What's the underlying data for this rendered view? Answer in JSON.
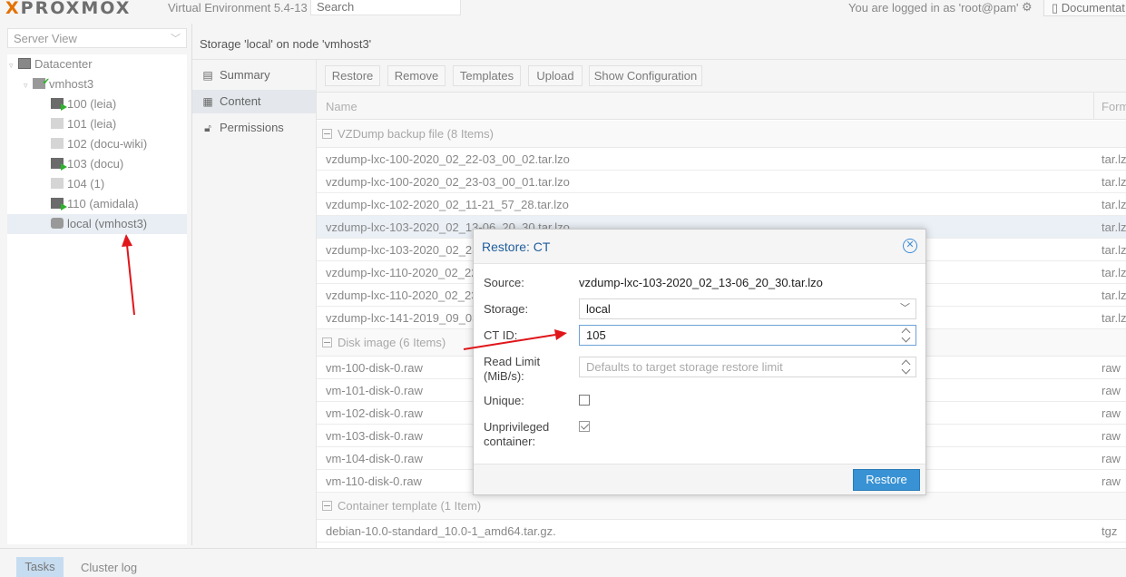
{
  "header": {
    "logo_x": "X",
    "logo_rest": "PROXMOX",
    "version": "Virtual Environment 5.4-13",
    "search_placeholder": "Search",
    "logged_in": "You are logged in as 'root@pam'",
    "gear_icon": "gear-icon",
    "docs_label": "Documentat"
  },
  "sidebar": {
    "view_select": "Server View",
    "tree": [
      {
        "label": "Datacenter",
        "icon": "datacenter-icon"
      },
      {
        "label": "vmhost3",
        "icon": "host-icon"
      },
      {
        "label": "100 (leia)",
        "icon": "container-running-icon"
      },
      {
        "label": "101 (leia)",
        "icon": "container-stopped-icon"
      },
      {
        "label": "102 (docu-wiki)",
        "icon": "container-stopped-icon"
      },
      {
        "label": "103 (docu)",
        "icon": "container-running-icon"
      },
      {
        "label": "104 (1)",
        "icon": "container-stopped-icon"
      },
      {
        "label": "110 (amidala)",
        "icon": "container-running-icon"
      },
      {
        "label": "local (vmhost3)",
        "icon": "storage-icon"
      }
    ]
  },
  "main": {
    "title": "Storage 'local' on node 'vmhost3'",
    "nav": [
      {
        "label": "Summary",
        "icon": "book-icon"
      },
      {
        "label": "Content",
        "icon": "grid-icon"
      },
      {
        "label": "Permissions",
        "icon": "unlock-icon"
      }
    ],
    "toolbar": {
      "restore": "Restore",
      "remove": "Remove",
      "templates": "Templates",
      "upload": "Upload",
      "show_config": "Show Configuration"
    },
    "columns": {
      "name": "Name",
      "format": "Form"
    },
    "groups": [
      {
        "title": "VZDump backup file (8 Items)",
        "rows": [
          {
            "name": "vzdump-lxc-100-2020_02_22-03_00_02.tar.lzo",
            "format": "tar.lz"
          },
          {
            "name": "vzdump-lxc-100-2020_02_23-03_00_01.tar.lzo",
            "format": "tar.lz"
          },
          {
            "name": "vzdump-lxc-102-2020_02_11-21_57_28.tar.lzo",
            "format": "tar.lz"
          },
          {
            "name": "vzdump-lxc-103-2020_02_13-06_20_30.tar.lzo",
            "format": "tar.lz"
          },
          {
            "name": "vzdump-lxc-103-2020_02_23",
            "format": "tar.lz"
          },
          {
            "name": "vzdump-lxc-110-2020_02_22",
            "format": "tar.lz"
          },
          {
            "name": "vzdump-lxc-110-2020_02_23",
            "format": "tar.lz"
          },
          {
            "name": "vzdump-lxc-141-2019_09_03",
            "format": "tar.lz"
          }
        ]
      },
      {
        "title": "Disk image (6 Items)",
        "rows": [
          {
            "name": "vm-100-disk-0.raw",
            "format": "raw"
          },
          {
            "name": "vm-101-disk-0.raw",
            "format": "raw"
          },
          {
            "name": "vm-102-disk-0.raw",
            "format": "raw"
          },
          {
            "name": "vm-103-disk-0.raw",
            "format": "raw"
          },
          {
            "name": "vm-104-disk-0.raw",
            "format": "raw"
          },
          {
            "name": "vm-110-disk-0.raw",
            "format": "raw"
          }
        ]
      },
      {
        "title": "Container template (1 Item)",
        "rows": [
          {
            "name": "debian-10.0-standard_10.0-1_amd64.tar.gz.",
            "format": "tgz"
          }
        ]
      }
    ]
  },
  "bottom": {
    "tasks": "Tasks",
    "cluster_log": "Cluster log"
  },
  "dialog": {
    "title": "Restore: CT",
    "source_label": "Source:",
    "source_value": "vzdump-lxc-103-2020_02_13-06_20_30.tar.lzo",
    "storage_label": "Storage:",
    "storage_value": "local",
    "ctid_label": "CT ID:",
    "ctid_value": "105",
    "readlimit_label_1": "Read Limit",
    "readlimit_label_2": "(MiB/s):",
    "readlimit_placeholder": "Defaults to target storage restore limit",
    "unique_label": "Unique:",
    "unique_checked": false,
    "unpriv_label_1": "Unprivileged",
    "unpriv_label_2": "container:",
    "unpriv_checked": true,
    "restore_button": "Restore"
  },
  "colors": {
    "accent": "#3892d4",
    "title_blue": "#1f5e9e",
    "arrow": "#e0161b",
    "running": "#2cb32c"
  }
}
